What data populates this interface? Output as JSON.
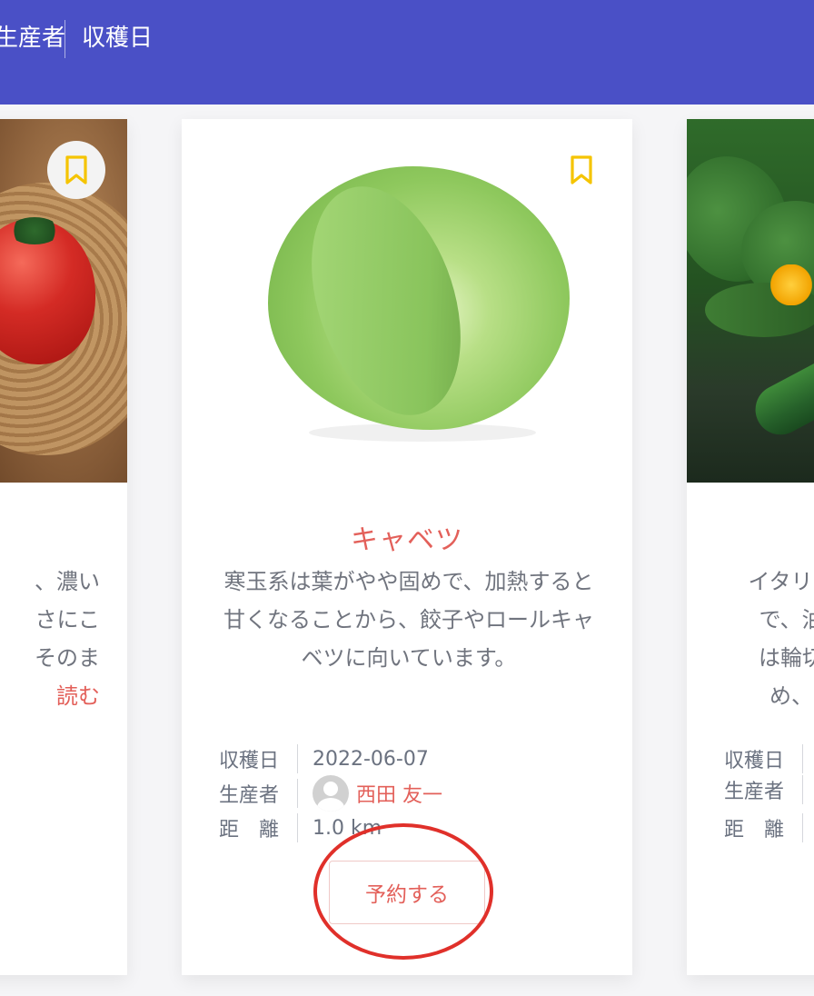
{
  "header": {
    "tabs": [
      {
        "label": "生産者"
      },
      {
        "label": "収穫日"
      }
    ]
  },
  "cards": {
    "left": {
      "desc_lines": [
        "、濃い",
        "さにこ",
        "そのま"
      ],
      "read_more": "読む",
      "bookmark_icon": "bookmark-icon"
    },
    "center": {
      "title": "キャベツ",
      "description": "寒玉系は葉がやや固めで、加熱すると甘くなることから、餃子やロールキャベツに向いています。",
      "labels": {
        "harvest": "収穫日",
        "producer": "生産者",
        "distance": "距　離"
      },
      "harvest_date": "2022-06-07",
      "producer_name": "西田 友一",
      "distance": "1.0 km",
      "reserve_label": "予約する",
      "bookmark_icon": "bookmark-icon"
    },
    "right": {
      "desc_lines": [
        "イタリア",
        "で、油",
        "は輪切",
        "め、"
      ],
      "labels": {
        "harvest": "収穫日",
        "producer": "生産者",
        "distance": "距　離"
      }
    }
  },
  "colors": {
    "header_bg": "#4a50c6",
    "accent": "#e3605a",
    "bookmark": "#f5c400",
    "highlight_ring": "#e0302a"
  }
}
